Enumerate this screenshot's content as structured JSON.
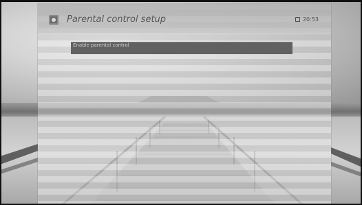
{
  "header": {
    "title": "Parental control setup",
    "time": "20:53",
    "icon": "settings-icon",
    "clock_icon": "clock-icon"
  },
  "menu": {
    "items": [
      {
        "label": "Enable parental control",
        "value": ""
      }
    ]
  },
  "colors": {
    "highlight_row": "#616161",
    "title_text": "#555555"
  }
}
